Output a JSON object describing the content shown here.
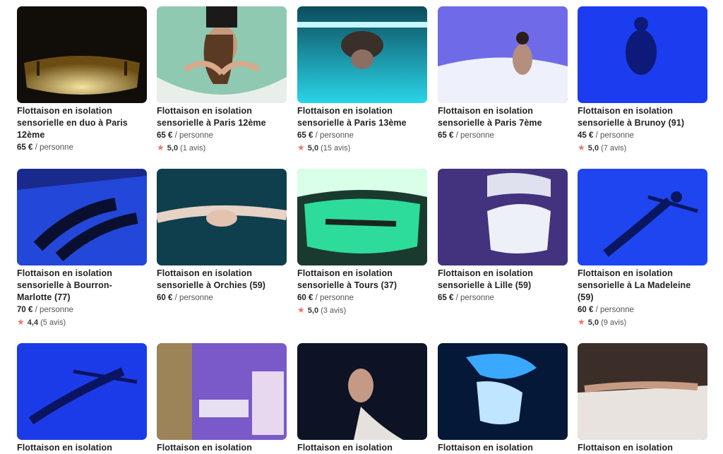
{
  "cards": [
    {
      "title": "Flottaison en isolation sensorielle en duo à Paris 12ème",
      "price": "65 €",
      "unit": "/ personne",
      "score": "",
      "count": "",
      "image": "float-pod-amber"
    },
    {
      "title": "Flottaison en isolation sensorielle à Paris 12ème",
      "price": "65 €",
      "unit": "/ personne",
      "score": "5,0",
      "count": "(1 avis)",
      "image": "woman-floating-mint"
    },
    {
      "title": "Flottaison en isolation sensorielle à Paris 13ème",
      "price": "65 €",
      "unit": "/ personne",
      "score": "5,0",
      "count": "(15 avis)",
      "image": "woman-floating-cyan"
    },
    {
      "title": "Flottaison en isolation sensorielle à Paris 7ème",
      "price": "65 €",
      "unit": "/ personne",
      "score": "",
      "count": "",
      "image": "woman-in-white-pod"
    },
    {
      "title": "Flottaison en isolation sensorielle à Brunoy (91)",
      "price": "45 €",
      "unit": "/ personne",
      "score": "5,0",
      "count": "(7 avis)",
      "image": "woman-floating-blue"
    },
    {
      "title": "Flottaison en isolation sensorielle à Bourron-Marlotte (77)",
      "price": "70 €",
      "unit": "/ personne",
      "score": "4,4",
      "count": "(5 avis)",
      "image": "couple-floating-blue-pool"
    },
    {
      "title": "Flottaison en isolation sensorielle à Orchies (59)",
      "price": "60 €",
      "unit": "/ personne",
      "score": "",
      "count": "",
      "image": "woman-floating-dark-water"
    },
    {
      "title": "Flottaison en isolation sensorielle à Tours (37)",
      "price": "60 €",
      "unit": "/ personne",
      "score": "5,0",
      "count": "(3 avis)",
      "image": "green-float-pod"
    },
    {
      "title": "Flottaison en isolation sensorielle à Lille (59)",
      "price": "65 €",
      "unit": "/ personne",
      "score": "",
      "count": "",
      "image": "white-pod-purple-room"
    },
    {
      "title": "Flottaison en isolation sensorielle à La Madeleine (59)",
      "price": "60 €",
      "unit": "/ personne",
      "score": "5,0",
      "count": "(9 avis)",
      "image": "person-floating-blue"
    },
    {
      "title": "Flottaison en isolation",
      "price": "",
      "unit": "",
      "score": "",
      "count": "",
      "image": "person-floating-deep-blue"
    },
    {
      "title": "Flottaison en isolation",
      "price": "",
      "unit": "",
      "score": "",
      "count": "",
      "image": "purple-spa-room"
    },
    {
      "title": "Flottaison en isolation",
      "price": "",
      "unit": "",
      "score": "",
      "count": "",
      "image": "woman-dark-water"
    },
    {
      "title": "Flottaison en isolation",
      "price": "",
      "unit": "",
      "score": "",
      "count": "",
      "image": "space-pod-blue"
    },
    {
      "title": "Flottaison en isolation",
      "price": "",
      "unit": "",
      "score": "",
      "count": "",
      "image": "woman-floating-warm"
    }
  ],
  "colors": {
    "star": "#e8786f",
    "text": "#222222"
  }
}
